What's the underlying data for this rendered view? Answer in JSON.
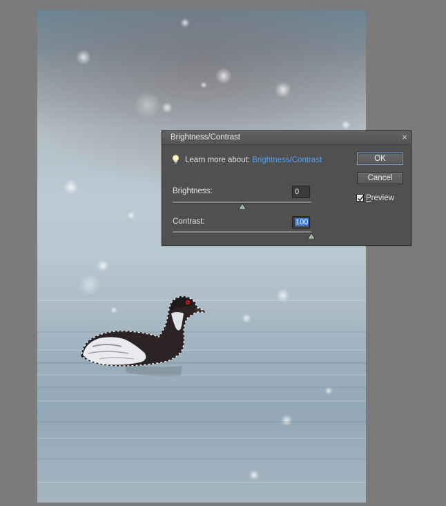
{
  "dialog": {
    "title": "Brightness/Contrast",
    "close_glyph": "×",
    "learn_prefix": "Learn more about:",
    "learn_link": "Brightness/Contrast",
    "brightness": {
      "label": "Brightness:",
      "value": "0",
      "slider_fraction": 0.5
    },
    "contrast": {
      "label": "Contrast:",
      "value": "100",
      "slider_fraction": 1.0
    },
    "ok_label": "OK",
    "cancel_label": "Cancel",
    "preview_first": "P",
    "preview_rest": "review",
    "preview_checked": true
  },
  "icons": {
    "hint": "lightbulb-icon",
    "close": "close-icon",
    "check": "checkmark-icon"
  },
  "colors": {
    "link": "#5aa0e8",
    "selection": "#3b76d6",
    "dialog_bg": "#505050",
    "workspace_bg": "#7b7b7b"
  }
}
